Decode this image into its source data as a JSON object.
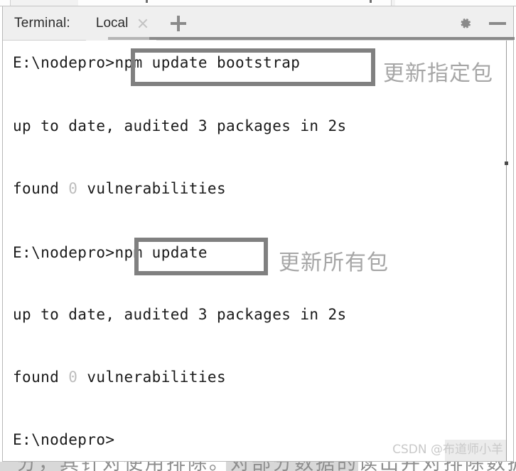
{
  "window": {
    "title_label": "Terminal:",
    "tab": {
      "label": "Local",
      "close_icon": "close-icon"
    },
    "add_tab_icon": "plus-icon",
    "settings_icon": "gear-icon",
    "minimize_icon": "minimize-icon"
  },
  "terminal": {
    "prompt": "E:\\nodepro>",
    "lines": [
      {
        "id": "cmd1",
        "prompt": "E:\\nodepro>",
        "command": "npm update bootstrap"
      },
      {
        "id": "out1a",
        "text": "up to date, audited 3 packages in 2s"
      },
      {
        "id": "out1b",
        "pre": "found ",
        "dim": "0",
        "post": " vulnerabilities"
      },
      {
        "id": "cmd2",
        "prompt": "E:\\nodepro>",
        "command": "npm update"
      },
      {
        "id": "out2a",
        "text": "up to date, audited 3 packages in 2s"
      },
      {
        "id": "out2b",
        "pre": "found ",
        "dim": "0",
        "post": " vulnerabilities"
      },
      {
        "id": "cmd3",
        "prompt": "E:\\nodepro>",
        "command": ""
      }
    ]
  },
  "annotations": [
    {
      "id": "a1",
      "text": "更新指定包"
    },
    {
      "id": "a2",
      "text": "更新所有包"
    }
  ],
  "watermark": {
    "text": "CSDN @布道师小羊"
  },
  "bottom_clipped_text": "分，其针对使用排除。对部分数据的读出并对排除数据范围读和分",
  "colors": {
    "highlight_box_border": "#808080",
    "annotation_text": "#a6a6a6",
    "terminal_text": "#1a1a1a",
    "dim_text": "#bdbdbd",
    "tabbar_bg": "#efefef",
    "watermark_text": "#c9c9c9"
  }
}
